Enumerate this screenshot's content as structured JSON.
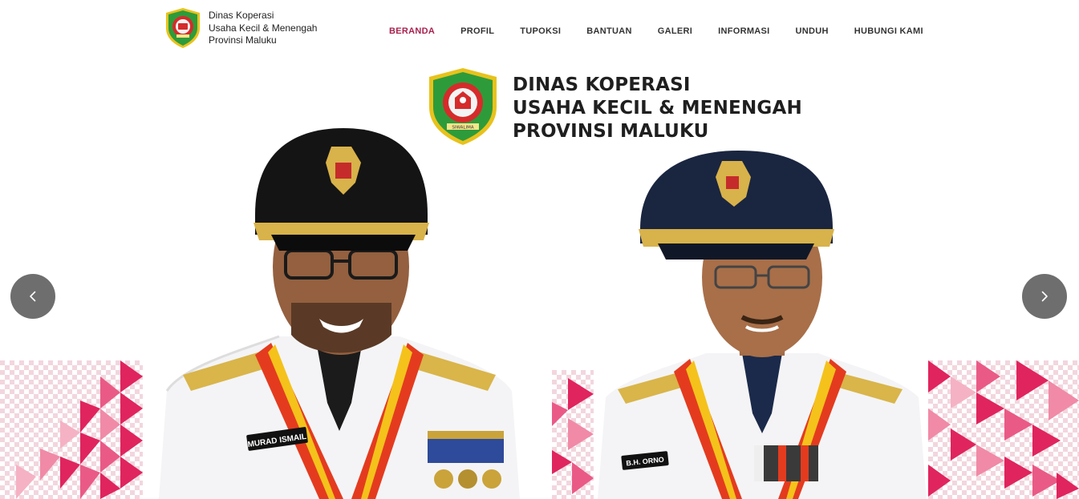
{
  "header": {
    "logo_line1": "Dinas Koperasi",
    "logo_line2": "Usaha Kecil & Menengah",
    "logo_line3": "Provinsi Maluku"
  },
  "nav": {
    "items": [
      {
        "label": "BERANDA",
        "active": true
      },
      {
        "label": "PROFIL"
      },
      {
        "label": "TUPOKSI"
      },
      {
        "label": "BANTUAN"
      },
      {
        "label": "GALERI"
      },
      {
        "label": "INFORMASI"
      },
      {
        "label": "UNDUH"
      },
      {
        "label": "HUBUNGI KAMI"
      }
    ]
  },
  "hero": {
    "title_line1": "DINAS KOPERASI",
    "title_line2": "USAHA KECIL & MENENGAH",
    "title_line3": "PROVINSI MALUKU",
    "emblem_ribbon": "SIWALIMA",
    "portrait1_nametag": "MURAD ISMAIL",
    "portrait2_nametag": "B.H. ORNO"
  },
  "slider": {
    "prev_icon": "chevron-left-icon",
    "next_icon": "chevron-right-icon"
  },
  "colors": {
    "accent": "#a8214d",
    "emblem_green": "#2e9b3a",
    "emblem_red": "#d62b2b",
    "pattern_red": "#e0245e"
  }
}
